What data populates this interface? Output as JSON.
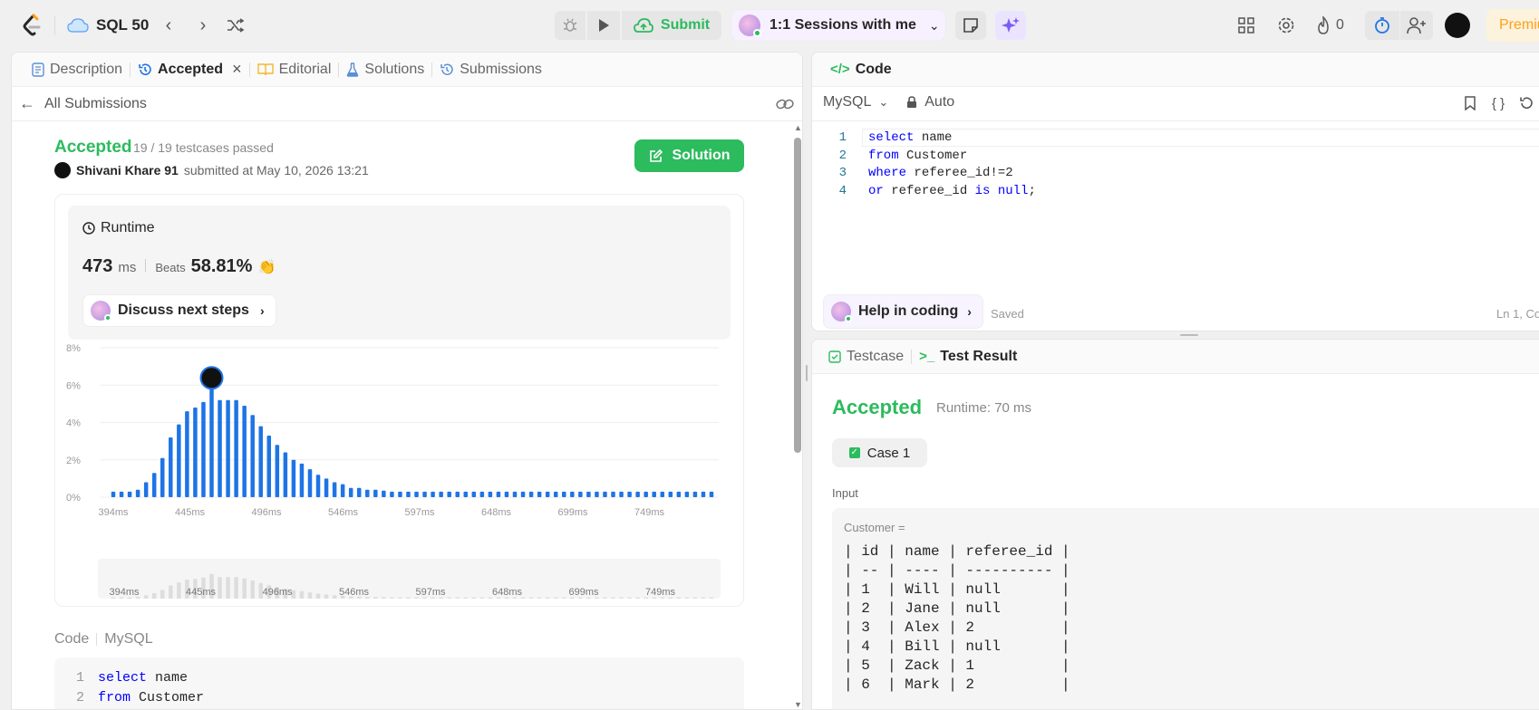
{
  "topbar": {
    "problem_list": "SQL 50",
    "submit_label": "Submit",
    "session_label": "1:1 Sessions with me",
    "streak": "0",
    "premium_label": "Premiu"
  },
  "left": {
    "tabs": [
      {
        "label": "Description"
      },
      {
        "label": "Accepted"
      },
      {
        "label": "Editorial"
      },
      {
        "label": "Solutions"
      },
      {
        "label": "Submissions"
      }
    ],
    "back_label": "All Submissions",
    "status": "Accepted",
    "testcases": "19 / 19 testcases passed",
    "user": "Shivani Khare 91",
    "submitted": "submitted at May 10, 2026 13:21",
    "solution_btn": "Solution",
    "runtime_title": "Runtime",
    "runtime_value": "473",
    "runtime_unit": "ms",
    "beats_label": "Beats",
    "beats_value": "58.81%",
    "discuss_label": "Discuss next steps",
    "code_label": "Code",
    "lang_label": "MySQL",
    "code_lines": [
      {
        "num": "1",
        "kw": "select",
        "rest": " name"
      },
      {
        "num": "2",
        "kw": "from",
        "rest": " Customer"
      }
    ]
  },
  "chart_data": {
    "type": "bar",
    "ylim": [
      0,
      8
    ],
    "yticks": [
      "8%",
      "6%",
      "4%",
      "2%",
      "0%"
    ],
    "xticks": [
      "394ms",
      "445ms",
      "496ms",
      "546ms",
      "597ms",
      "648ms",
      "699ms",
      "749ms"
    ],
    "values": [
      0.3,
      0.3,
      0.3,
      0.4,
      0.8,
      1.3,
      2.1,
      3.2,
      3.9,
      4.6,
      4.8,
      5.1,
      6.0,
      5.2,
      5.2,
      5.2,
      4.9,
      4.4,
      3.8,
      3.3,
      2.8,
      2.4,
      2.0,
      1.8,
      1.5,
      1.2,
      1.0,
      0.8,
      0.7,
      0.5,
      0.5,
      0.4,
      0.4,
      0.35,
      0.3,
      0.3,
      0.3,
      0.3,
      0.3,
      0.3,
      0.3,
      0.3,
      0.3,
      0.3,
      0.3,
      0.3,
      0.3,
      0.3,
      0.3,
      0.3,
      0.3,
      0.3,
      0.3,
      0.3,
      0.3,
      0.3,
      0.3,
      0.3,
      0.3,
      0.3,
      0.3,
      0.3,
      0.3,
      0.3,
      0.3,
      0.3,
      0.3,
      0.3,
      0.3,
      0.3,
      0.3,
      0.3,
      0.3,
      0.3
    ],
    "highlight_index": 12,
    "bar_color": "#1e74e6"
  },
  "editor": {
    "title": "Code",
    "lang": "MySQL",
    "mode": "Auto",
    "lines": [
      {
        "num": "1",
        "parts": [
          {
            "t": "select",
            "k": true
          },
          {
            "t": " name",
            "k": false
          }
        ]
      },
      {
        "num": "2",
        "parts": [
          {
            "t": "from",
            "k": true
          },
          {
            "t": " Customer",
            "k": false
          }
        ]
      },
      {
        "num": "3",
        "parts": [
          {
            "t": "where",
            "k": true
          },
          {
            "t": " referee_id!=2",
            "k": false
          }
        ]
      },
      {
        "num": "4",
        "parts": [
          {
            "t": "or",
            "k": true
          },
          {
            "t": " referee_id ",
            "k": false
          },
          {
            "t": "is null",
            "k": true
          },
          {
            "t": ";",
            "k": false
          }
        ]
      }
    ],
    "help_label": "Help in coding",
    "saved": "Saved",
    "cursor_pos": "Ln 1, Co"
  },
  "result": {
    "tab_testcase": "Testcase",
    "tab_result": "Test Result",
    "status": "Accepted",
    "runtime": "Runtime: 70 ms",
    "case_label": "Case 1",
    "input_label": "Input",
    "var_label": "Customer =",
    "table_rows": [
      "| id | name | referee_id |",
      "| -- | ---- | ---------- |",
      "| 1  | Will | null       |",
      "| 2  | Jane | null       |",
      "| 3  | Alex | 2          |",
      "| 4  | Bill | null       |",
      "| 5  | Zack | 1          |",
      "| 6  | Mark | 2          |"
    ]
  },
  "colors": {
    "accent": "#2cbb5d",
    "orange": "#ffa116",
    "blue": "#1e74e6"
  }
}
